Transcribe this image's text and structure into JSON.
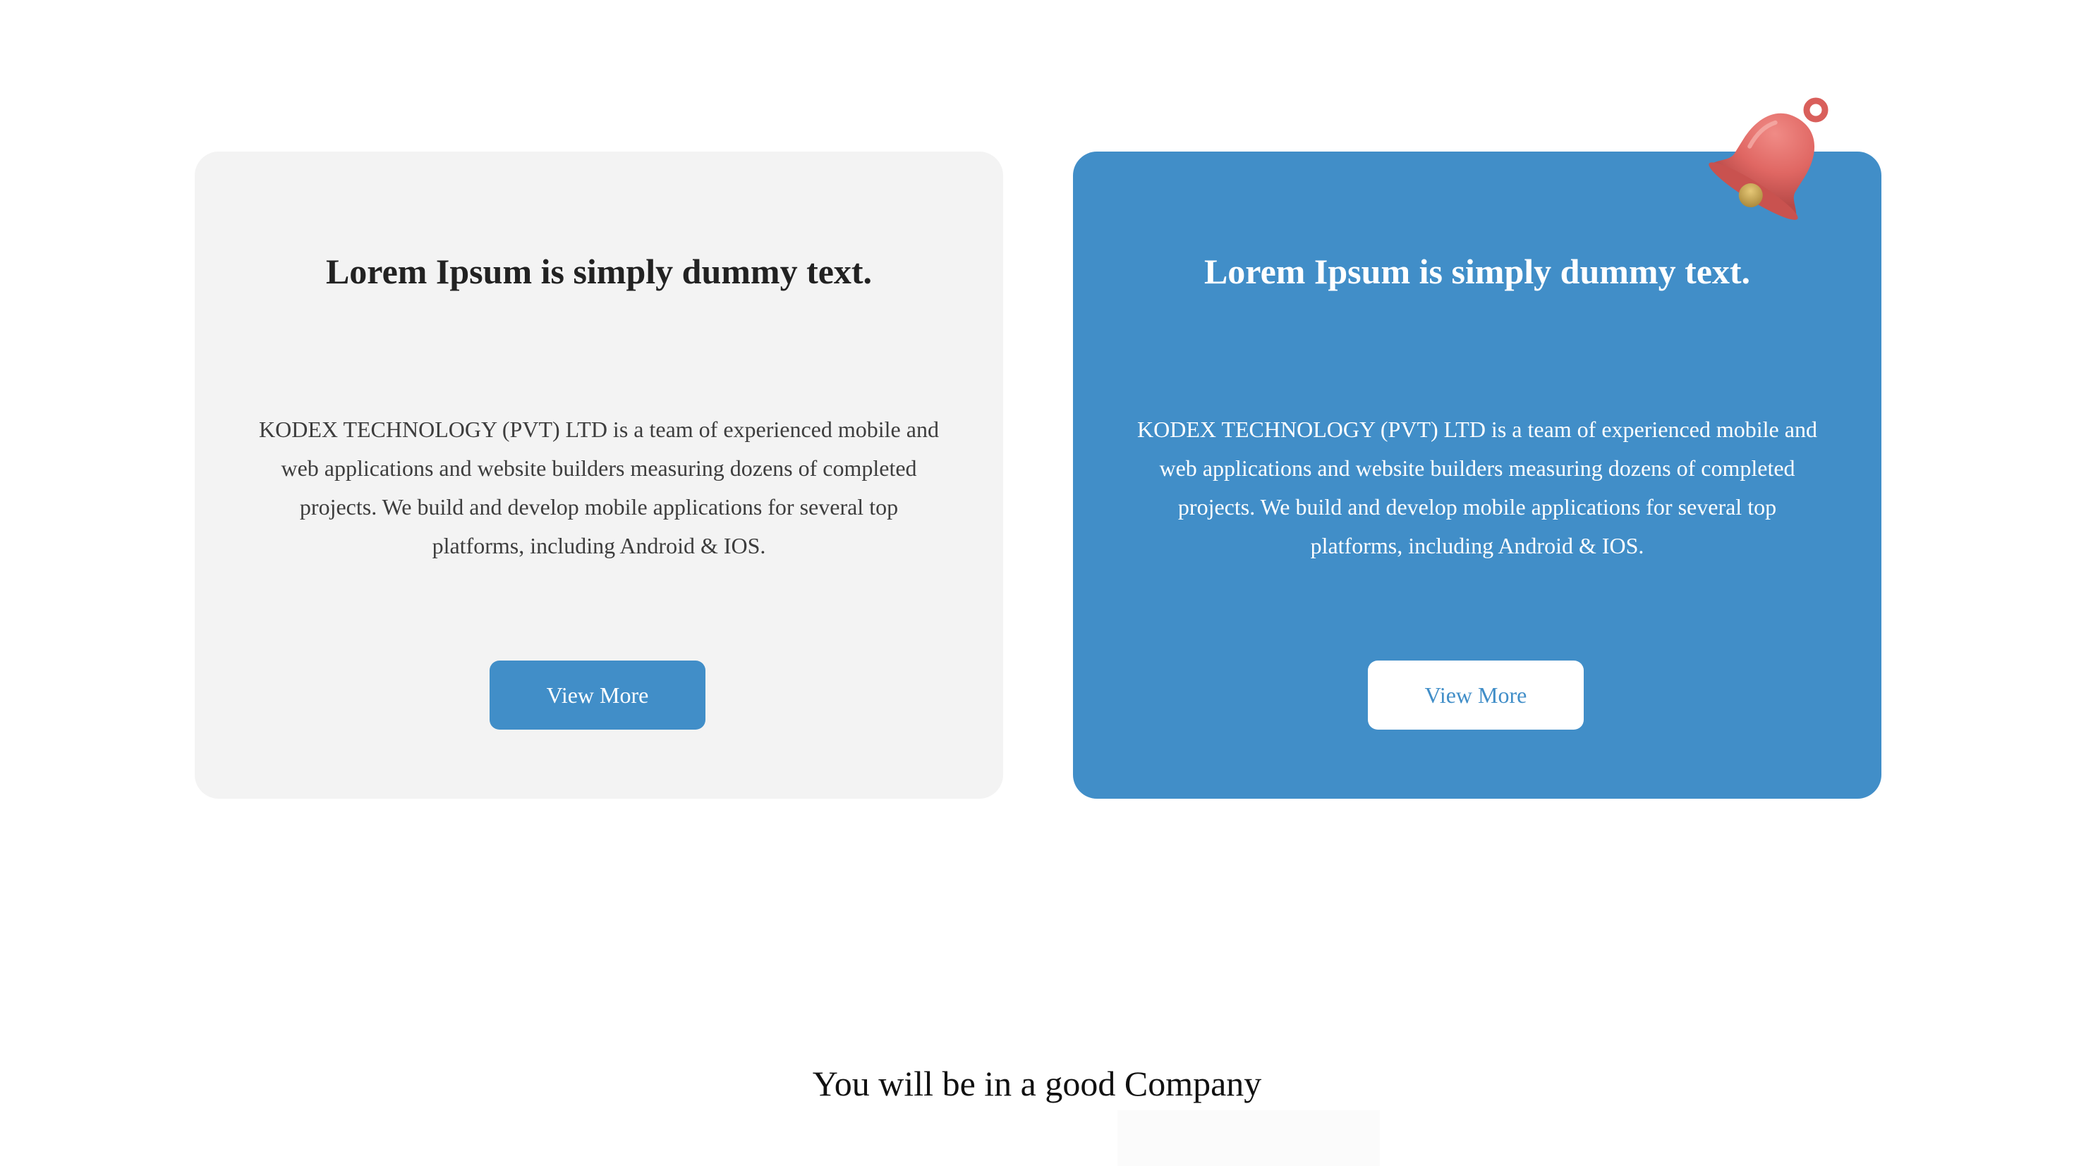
{
  "cards": [
    {
      "title": "Lorem Ipsum is simply dummy text.",
      "description": "KODEX TECHNOLOGY (PVT) LTD is a team of experienced mobile and web applications and website builders measuring dozens of completed projects. We build and develop mobile applications for several top platforms, including Android & IOS.",
      "button_label": "View More",
      "theme": "light"
    },
    {
      "title": "Lorem Ipsum is simply dummy text.",
      "description": "KODEX TECHNOLOGY (PVT) LTD is a team of experienced mobile and web applications and website builders measuring dozens of completed projects. We build and develop mobile applications for several top platforms, including Android & IOS.",
      "button_label": "View More",
      "theme": "blue",
      "badge_icon": "bell-icon"
    }
  ],
  "company_section": {
    "heading": "You will be in a good Company"
  },
  "colors": {
    "accent": "#418ec8",
    "card_light_bg": "#f3f3f3",
    "text_dark": "#222222",
    "bell_red": "#e06763",
    "bell_clapper": "#c9a24a"
  }
}
